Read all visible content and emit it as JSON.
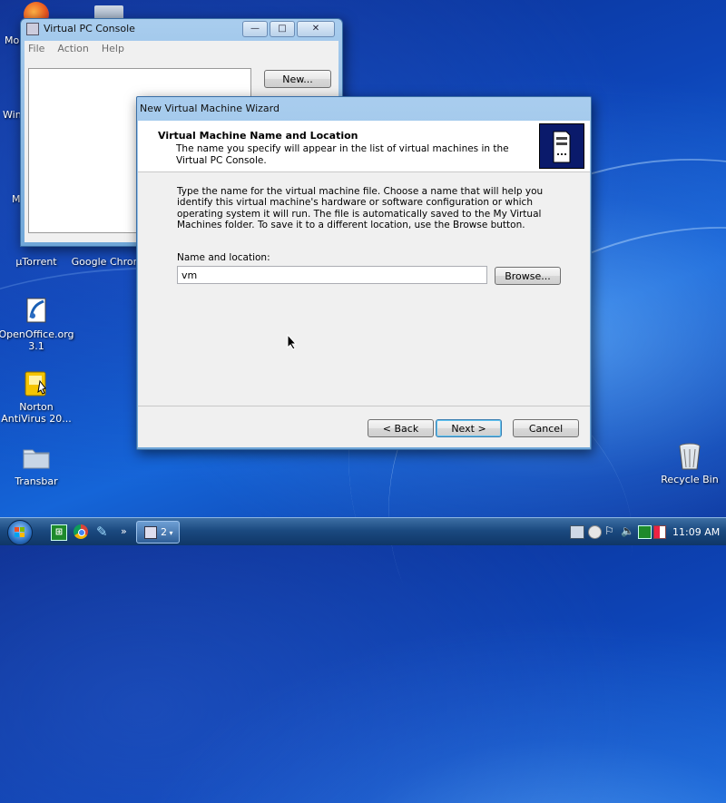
{
  "desktop": {
    "icons": [
      {
        "label": "µTorrent"
      },
      {
        "label": "Google Chrom"
      },
      {
        "label": "OpenOffice.org 3.1"
      },
      {
        "label": "Norton AntiVirus 20..."
      },
      {
        "label": "Transbar"
      },
      {
        "label": "Recycle Bin"
      }
    ],
    "partial_labels": [
      "Mo",
      "Win",
      "M"
    ]
  },
  "console_window": {
    "title": "Virtual PC Console",
    "menu": [
      "File",
      "Action",
      "Help"
    ],
    "new_button": "New...",
    "controls": {
      "minimize": "—",
      "maximize": "□",
      "close": "✕"
    }
  },
  "wizard": {
    "title": "New Virtual Machine Wizard",
    "header_title": "Virtual Machine Name and Location",
    "header_subtitle": "The name you specify will appear in the list of virtual machines in the Virtual PC Console.",
    "description": "Type the name for the virtual machine file. Choose a name that will help you identify this virtual machine's hardware or software configuration or which operating system it will run. The file is automatically saved to the My Virtual Machines folder. To save it to a different location, use the Browse button.",
    "field_label": "Name and location:",
    "field_value": "vm",
    "browse_button": "Browse...",
    "back_button": "< Back",
    "next_button": "Next >",
    "cancel_button": "Cancel"
  },
  "taskbar": {
    "window_count": "2",
    "overflow": "»",
    "clock": "11:09 AM"
  },
  "icons": [
    "start-orb-icon",
    "terminal-icon",
    "chrome-icon",
    "edit-icon",
    "virtual-pc-icon",
    "network-icon",
    "volume-icon",
    "recycle-bin-icon"
  ]
}
